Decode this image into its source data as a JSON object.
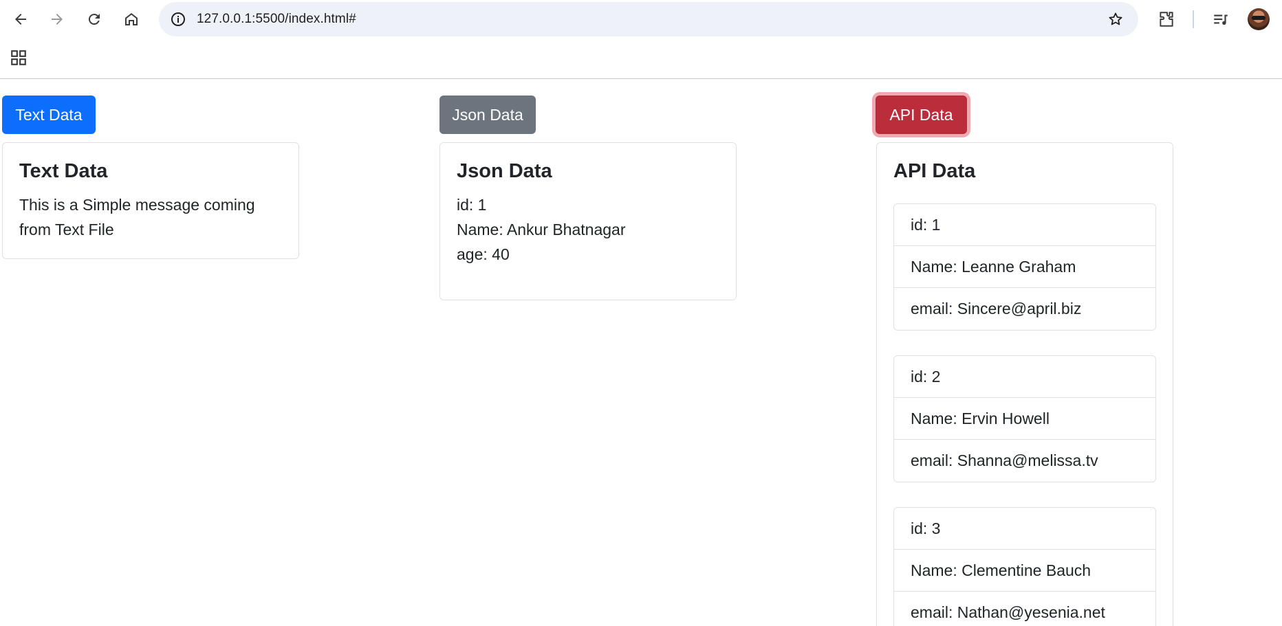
{
  "browser": {
    "url": "127.0.0.1:5500/index.html#",
    "icons": [
      "back-arrow-icon",
      "forward-arrow-icon",
      "reload-icon",
      "home-icon",
      "site-info-icon",
      "bookmark-star-icon",
      "extensions-icon",
      "media-controls-icon",
      "profile-avatar",
      "apps-grid-icon"
    ]
  },
  "buttons": {
    "text": "Text Data",
    "json": "Json Data",
    "api": "API Data"
  },
  "colors": {
    "primary": "#0d6efd",
    "secondary": "#6c757d",
    "danger": "#bb2d3b"
  },
  "text_card": {
    "title": "Text Data",
    "body": "This is a Simple message coming from Text File"
  },
  "json_card": {
    "title": "Json Data",
    "id": "id: 1",
    "name": "Name: Ankur Bhatnagar",
    "age": "age: 40"
  },
  "api_card": {
    "title": "API Data",
    "users": [
      {
        "id": "id: 1",
        "name": "Name: Leanne Graham",
        "email": "email: Sincere@april.biz"
      },
      {
        "id": "id: 2",
        "name": "Name: Ervin Howell",
        "email": "email: Shanna@melissa.tv"
      },
      {
        "id": "id: 3",
        "name": "Name: Clementine Bauch",
        "email": "email: Nathan@yesenia.net"
      }
    ]
  }
}
